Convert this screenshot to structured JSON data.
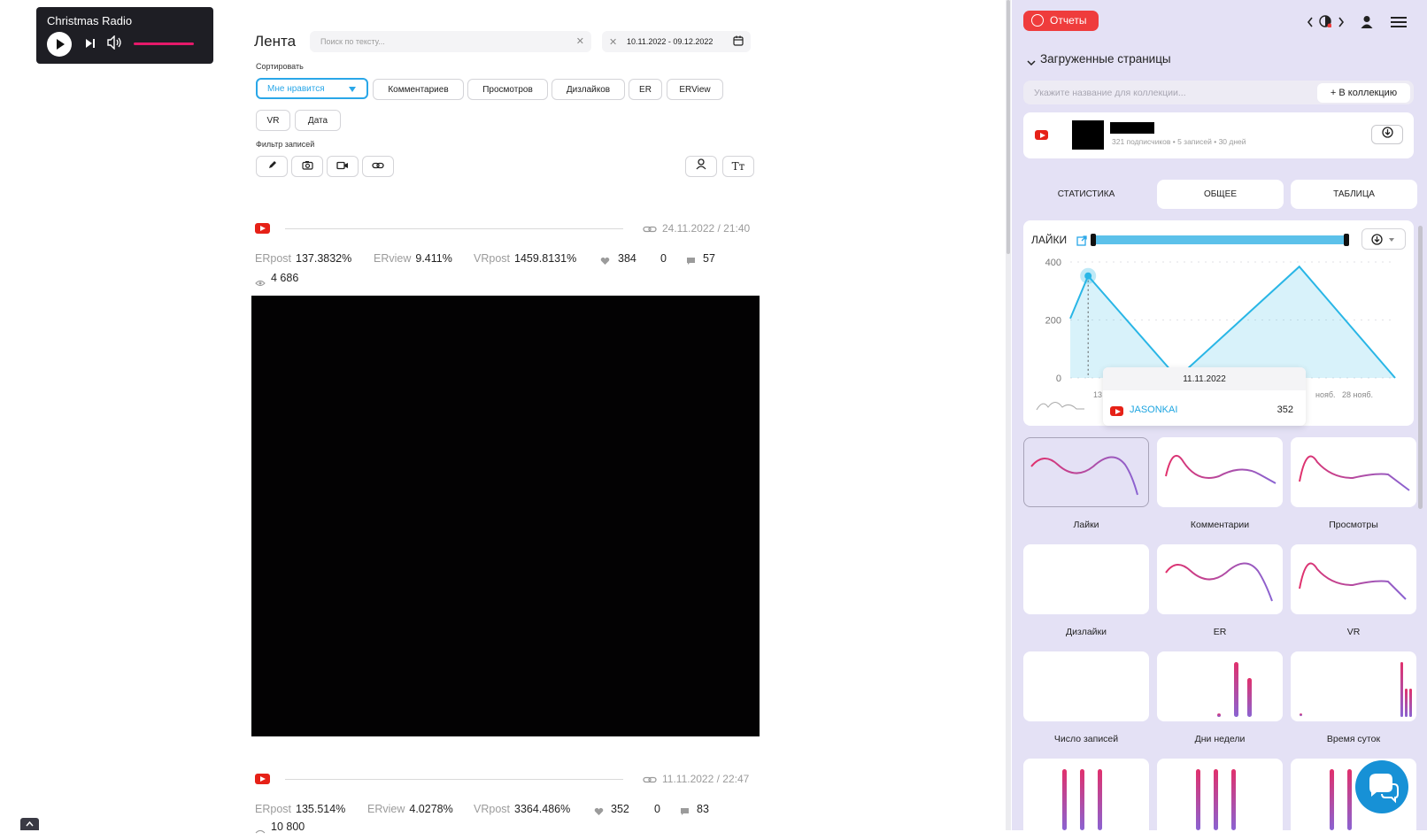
{
  "player": {
    "title": "Christmas Radio"
  },
  "feed": {
    "title": "Лента",
    "search_placeholder": "Поиск по тексту...",
    "date_range": "10.11.2022 - 09.12.2022",
    "sort_label": "Сортировать",
    "sort_options": [
      "Мне нравится",
      "Комментариев",
      "Просмотров",
      "Дизлайков",
      "ER",
      "ERView",
      "VR",
      "Дата"
    ],
    "filter_label": "Фильтр записей",
    "posts": [
      {
        "date": "24.11.2022 / 21:40",
        "erpost_label": "ERpost",
        "erpost": "137.3832%",
        "erview_label": "ERview",
        "erview": "9.411%",
        "vrpost_label": "VRpost",
        "vrpost": "1459.8131%",
        "likes": "384",
        "dislikes": "0",
        "comments": "57",
        "views": "4 686"
      },
      {
        "date": "11.11.2022 / 22:47",
        "erpost_label": "ERpost",
        "erpost": "135.514%",
        "erview_label": "ERview",
        "erview": "4.0278%",
        "vrpost_label": "VRpost",
        "vrpost": "3364.486%",
        "likes": "352",
        "dislikes": "0",
        "comments": "83",
        "views": "10 800"
      }
    ]
  },
  "panel": {
    "reports_label": "Отчеты",
    "loaded_pages_label": "Загруженные страницы",
    "collection_placeholder": "Укажите название для коллекции...",
    "add_collection_label": "+ В коллекцию",
    "channel_meta": "321 подписчиков • 5 записей • 30 дней",
    "tabs": [
      "СТАТИСТИКА",
      "ОБЩЕЕ",
      "ТАБЛИЦА"
    ],
    "chart_title": "ЛАЙКИ",
    "tooltip_date": "11.11.2022",
    "tooltip_series": "JASONKAI",
    "tooltip_value": "352",
    "mini_labels": [
      "Лайки",
      "Комментарии",
      "Просмотры",
      "Дизлайки",
      "ER",
      "VR",
      "Число записей",
      "Дни недели",
      "Время суток"
    ]
  },
  "chart_data": {
    "type": "area",
    "x": [
      "10.11.2022",
      "11.11.2022",
      "24.11.2022",
      "09.12.2022"
    ],
    "values": [
      205,
      352,
      0,
      384,
      0
    ],
    "x_tick_labels": [
      "13",
      "нояб.",
      "28 нояб."
    ],
    "y_ticks": [
      "0",
      "200",
      "400"
    ],
    "ylim": [
      0,
      400
    ],
    "series": [
      {
        "name": "JASONKAI",
        "values": [
          205,
          352,
          0,
          384,
          0
        ]
      }
    ],
    "color": "#29b6e6"
  }
}
